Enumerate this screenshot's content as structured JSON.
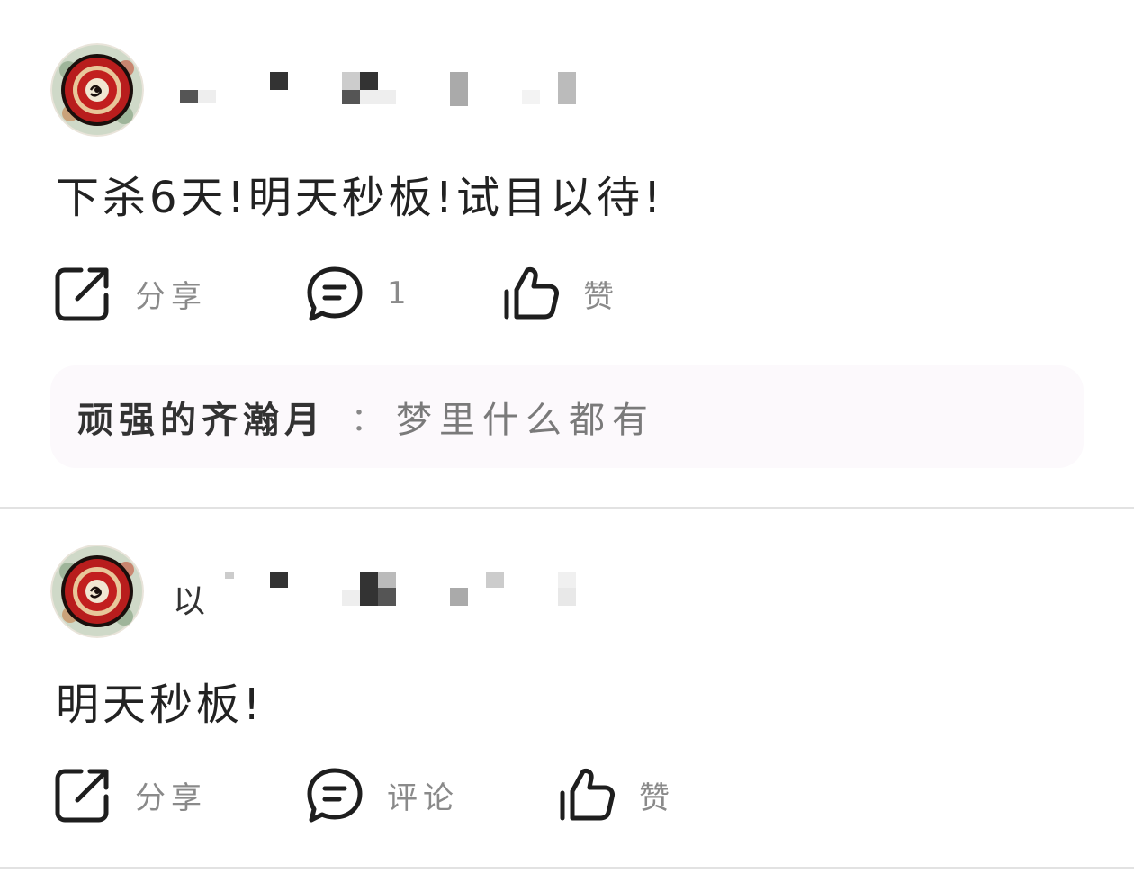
{
  "posts": [
    {
      "username_visible": "",
      "text": "下杀6天!明天秒板!试目以待!",
      "actions": {
        "share_label": "分享",
        "comment_label": "1",
        "like_label": "赞"
      },
      "comment_preview": {
        "author": "顽强的齐瀚月",
        "separator": "：",
        "text": "梦里什么都有"
      }
    },
    {
      "username_visible": "以",
      "text": "明天秒板!",
      "actions": {
        "share_label": "分享",
        "comment_label": "评论",
        "like_label": "赞"
      }
    }
  ],
  "icons": {
    "share": "share-icon",
    "comment": "comment-bubble-icon",
    "like": "thumbs-up-icon",
    "avatar": "decorative-plate-avatar"
  },
  "colors": {
    "background": "#ffffff",
    "divider": "#e2e2e2",
    "comment_bg": "#fcf9fc",
    "icon": "#1e1e1e",
    "label": "#8a8a8a"
  }
}
